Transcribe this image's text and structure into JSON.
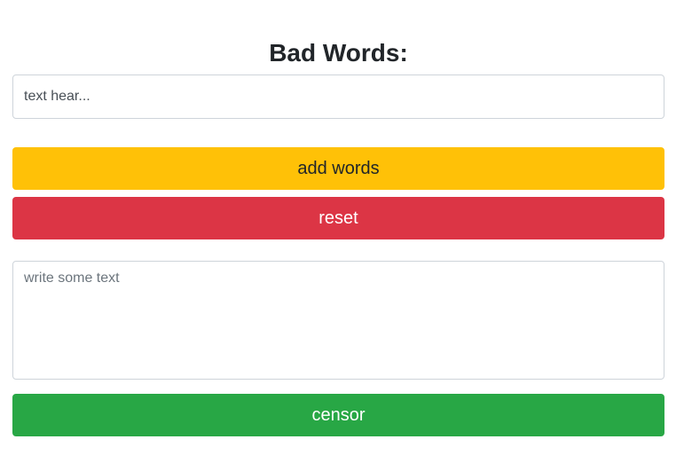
{
  "header": {
    "title": "Bad Words:"
  },
  "bad_words_input": {
    "placeholder": "text hear...",
    "value": ""
  },
  "buttons": {
    "add_words": "add words",
    "reset": "reset",
    "censor": "censor"
  },
  "text_area": {
    "placeholder": "write some text",
    "value": ""
  },
  "colors": {
    "add_words_button": "#ffc107",
    "reset_button": "#dc3545",
    "censor_button": "#28a745",
    "input_border": "#ced4da"
  }
}
